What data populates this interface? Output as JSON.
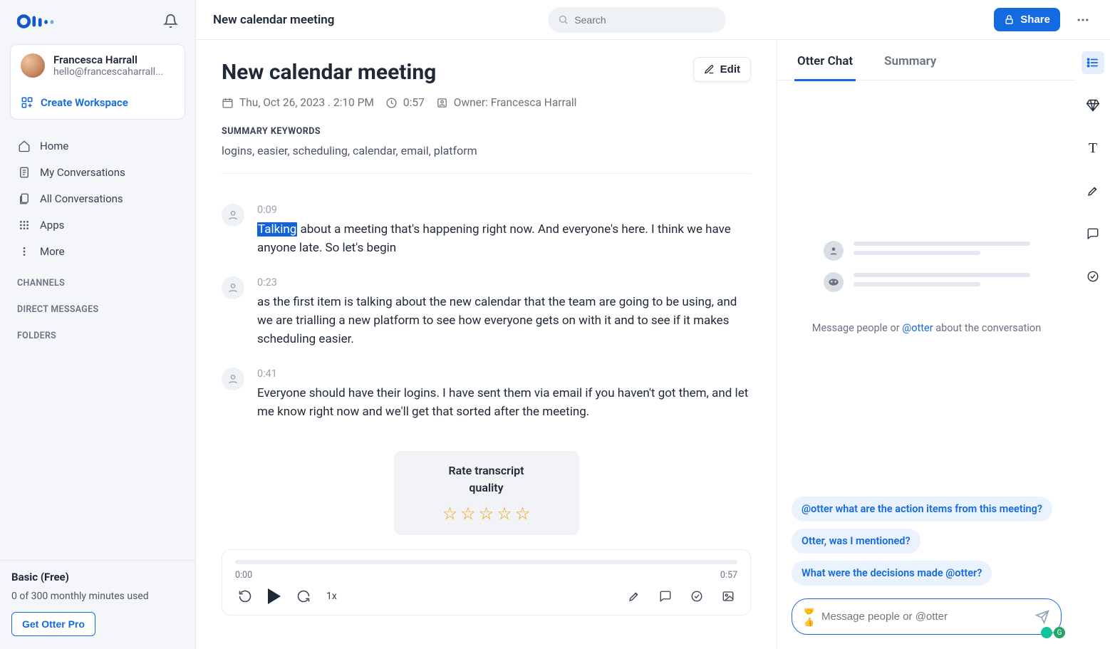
{
  "app": {
    "title": "New calendar meeting",
    "search_placeholder": "Search"
  },
  "share_button": "Share",
  "user": {
    "name": "Francesca Harrall",
    "email": "hello@francescaharrall...",
    "create_workspace": "Create Workspace"
  },
  "nav": {
    "home": "Home",
    "my_conversations": "My Conversations",
    "all_conversations": "All Conversations",
    "apps": "Apps",
    "more": "More"
  },
  "sections": {
    "channels": "CHANNELS",
    "direct_messages": "DIRECT MESSAGES",
    "folders": "FOLDERS"
  },
  "plan": {
    "label": "Basic (Free)",
    "usage": "0 of 300 monthly minutes used",
    "cta": "Get Otter Pro"
  },
  "meeting": {
    "title": "New calendar meeting",
    "edit": "Edit",
    "date": "Thu, Oct 26, 2023 . 2:10 PM",
    "duration": "0:57",
    "owner": "Owner: Francesca Harrall",
    "keywords_label": "SUMMARY KEYWORDS",
    "keywords": "logins, easier, scheduling, calendar, email, platform"
  },
  "transcript": [
    {
      "ts": "0:09",
      "highlight": "Talking",
      "text": " about a meeting that's happening right now. And everyone's here. I think we have anyone late. So let's begin"
    },
    {
      "ts": "0:23",
      "text": "as the first item is talking about the new calendar that the team are going to be using, and we are trialling a new platform to see how everyone gets on with it and to see if it makes scheduling easier."
    },
    {
      "ts": "0:41",
      "text": "Everyone should have their logins. I have sent them via email if you haven't got them, and let me know right now and we'll get that sorted after the meeting."
    }
  ],
  "rate": {
    "title_l1": "Rate transcript",
    "title_l2": "quality"
  },
  "player": {
    "start": "0:00",
    "end": "0:57",
    "speed": "1x"
  },
  "tabs": {
    "chat": "Otter Chat",
    "summary": "Summary"
  },
  "chat": {
    "hint_pre": "Message people or ",
    "hint_mention": "@otter",
    "hint_post": " about the conversation",
    "suggest1": "@otter what are the action items from this meeting?",
    "suggest2": "Otter, was I mentioned?",
    "suggest3": "What were the decisions made @otter?",
    "placeholder": "Message people or @otter"
  }
}
